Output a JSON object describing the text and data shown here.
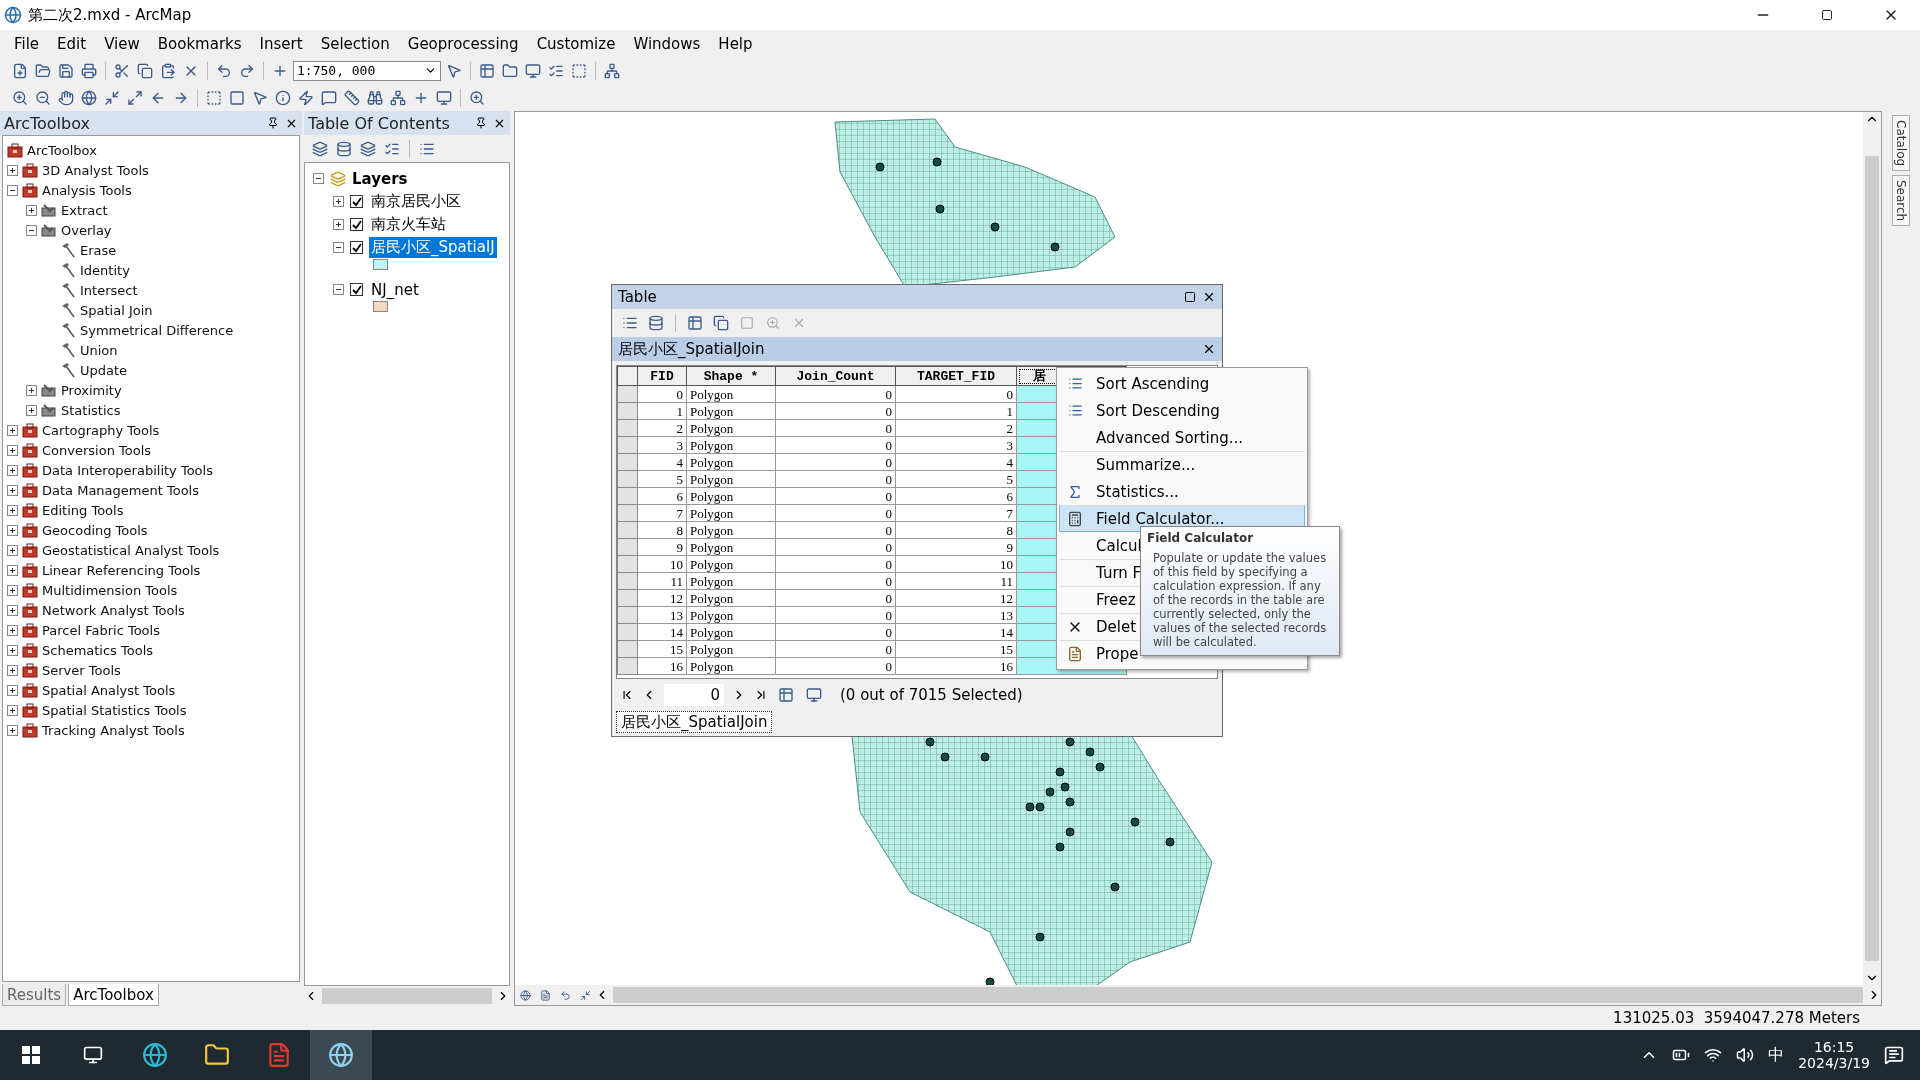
{
  "window": {
    "title": "第二次2.mxd - ArcMap"
  },
  "menu": [
    "File",
    "Edit",
    "View",
    "Bookmarks",
    "Insert",
    "Selection",
    "Geoprocessing",
    "Customize",
    "Windows",
    "Help"
  ],
  "toolbar": {
    "scale": "1:750, 000"
  },
  "arctoolbox": {
    "title": "ArcToolbox",
    "root": "ArcToolbox",
    "items": [
      {
        "label": "3D Analyst Tools",
        "kind": "toolbox",
        "expanded": false
      },
      {
        "label": "Analysis Tools",
        "kind": "toolbox",
        "expanded": true,
        "children": [
          {
            "label": "Extract",
            "kind": "toolset",
            "expanded": false
          },
          {
            "label": "Overlay",
            "kind": "toolset",
            "expanded": true,
            "children": [
              {
                "label": "Erase",
                "kind": "tool"
              },
              {
                "label": "Identity",
                "kind": "tool"
              },
              {
                "label": "Intersect",
                "kind": "tool"
              },
              {
                "label": "Spatial Join",
                "kind": "tool"
              },
              {
                "label": "Symmetrical Difference",
                "kind": "tool"
              },
              {
                "label": "Union",
                "kind": "tool"
              },
              {
                "label": "Update",
                "kind": "tool"
              }
            ]
          },
          {
            "label": "Proximity",
            "kind": "toolset",
            "expanded": false
          },
          {
            "label": "Statistics",
            "kind": "toolset",
            "expanded": false
          }
        ]
      },
      {
        "label": "Cartography Tools",
        "kind": "toolbox",
        "expanded": false
      },
      {
        "label": "Conversion Tools",
        "kind": "toolbox",
        "expanded": false
      },
      {
        "label": "Data Interoperability Tools",
        "kind": "toolbox",
        "expanded": false
      },
      {
        "label": "Data Management Tools",
        "kind": "toolbox",
        "expanded": false
      },
      {
        "label": "Editing Tools",
        "kind": "toolbox",
        "expanded": false
      },
      {
        "label": "Geocoding Tools",
        "kind": "toolbox",
        "expanded": false
      },
      {
        "label": "Geostatistical Analyst Tools",
        "kind": "toolbox",
        "expanded": false
      },
      {
        "label": "Linear Referencing Tools",
        "kind": "toolbox",
        "expanded": false
      },
      {
        "label": "Multidimension Tools",
        "kind": "toolbox",
        "expanded": false
      },
      {
        "label": "Network Analyst Tools",
        "kind": "toolbox",
        "expanded": false
      },
      {
        "label": "Parcel Fabric Tools",
        "kind": "toolbox",
        "expanded": false
      },
      {
        "label": "Schematics Tools",
        "kind": "toolbox",
        "expanded": false
      },
      {
        "label": "Server Tools",
        "kind": "toolbox",
        "expanded": false
      },
      {
        "label": "Spatial Analyst Tools",
        "kind": "toolbox",
        "expanded": false
      },
      {
        "label": "Spatial Statistics Tools",
        "kind": "toolbox",
        "expanded": false
      },
      {
        "label": "Tracking Analyst Tools",
        "kind": "toolbox",
        "expanded": false
      }
    ]
  },
  "panel_tabs": [
    {
      "label": "Results",
      "selected": false
    },
    {
      "label": "ArcToolbox",
      "selected": true
    }
  ],
  "toc": {
    "title": "Table Of Contents",
    "group": "Layers",
    "layers": [
      {
        "label": "南京居民小区",
        "checked": true,
        "expanded": false,
        "selected": false
      },
      {
        "label": "南京火车站",
        "checked": true,
        "expanded": false,
        "selected": false
      },
      {
        "label": "居民小区_SpatialJ",
        "checked": true,
        "expanded": true,
        "selected": true,
        "color": "#c6f2f2"
      },
      {
        "label": "NJ_net",
        "checked": true,
        "expanded": true,
        "selected": false,
        "color": "#f6d8bf"
      }
    ]
  },
  "side_tabs": [
    "Catalog",
    "Search"
  ],
  "table": {
    "title": "Table",
    "tab_title": "居民小区_SpatialJoin",
    "columns": [
      {
        "label": "FID",
        "selected": false
      },
      {
        "label": "Shape *",
        "selected": false
      },
      {
        "label": "Join_Count",
        "selected": false
      },
      {
        "label": "TARGET_FID",
        "selected": false
      },
      {
        "label": "居",
        "selected": true
      }
    ],
    "rows": [
      [
        "0",
        "Polygon",
        "0",
        "0"
      ],
      [
        "1",
        "Polygon",
        "0",
        "1"
      ],
      [
        "2",
        "Polygon",
        "0",
        "2"
      ],
      [
        "3",
        "Polygon",
        "0",
        "3"
      ],
      [
        "4",
        "Polygon",
        "0",
        "4"
      ],
      [
        "5",
        "Polygon",
        "0",
        "5"
      ],
      [
        "6",
        "Polygon",
        "0",
        "6"
      ],
      [
        "7",
        "Polygon",
        "0",
        "7"
      ],
      [
        "8",
        "Polygon",
        "0",
        "8"
      ],
      [
        "9",
        "Polygon",
        "0",
        "9"
      ],
      [
        "10",
        "Polygon",
        "0",
        "10"
      ],
      [
        "11",
        "Polygon",
        "0",
        "11"
      ],
      [
        "12",
        "Polygon",
        "0",
        "12"
      ],
      [
        "13",
        "Polygon",
        "0",
        "13"
      ],
      [
        "14",
        "Polygon",
        "0",
        "14"
      ],
      [
        "15",
        "Polygon",
        "0",
        "15"
      ],
      [
        "16",
        "Polygon",
        "0",
        "16"
      ]
    ],
    "record": "0",
    "selection": "(0 out of 7015 Selected)",
    "bottom_tab": "居民小区_SpatialJoin"
  },
  "context_menu": [
    {
      "label": "Sort Ascending",
      "kind": "sort_up",
      "group_start": false,
      "selected": false
    },
    {
      "label": "Sort Descending",
      "kind": "sort_down",
      "group_start": false,
      "selected": false
    },
    {
      "label": "Advanced Sorting...",
      "kind": "plain",
      "group_start": false,
      "selected": false
    },
    {
      "label": "Summarize...",
      "kind": "plain",
      "group_start": true,
      "selected": false
    },
    {
      "label": "Statistics...",
      "kind": "sigma",
      "group_start": false,
      "selected": false
    },
    {
      "label": "Field Calculator...",
      "kind": "calculator",
      "group_start": true,
      "selected": true
    },
    {
      "label": "Calcul",
      "kind": "plain",
      "group_start": false,
      "selected": false
    },
    {
      "label": "Turn F",
      "kind": "plain",
      "group_start": true,
      "selected": false
    },
    {
      "label": "Freez",
      "kind": "plain",
      "group_start": true,
      "selected": false
    },
    {
      "label": "Delet",
      "kind": "delete",
      "group_start": true,
      "selected": false
    },
    {
      "label": "Prope",
      "kind": "properties",
      "group_start": true,
      "selected": false
    }
  ],
  "tooltip": {
    "title": "Field Calculator",
    "body": "Populate or update the values of this field by specifying a calculation expression. If any of the records in the table are currently selected, only the values of the selected records will be calculated."
  },
  "status_bar": {
    "coordinates": "131025.03  3594047.278 Meters"
  },
  "taskbar": {
    "ime": "中",
    "time": "16:15",
    "date": "2024/3/19"
  }
}
